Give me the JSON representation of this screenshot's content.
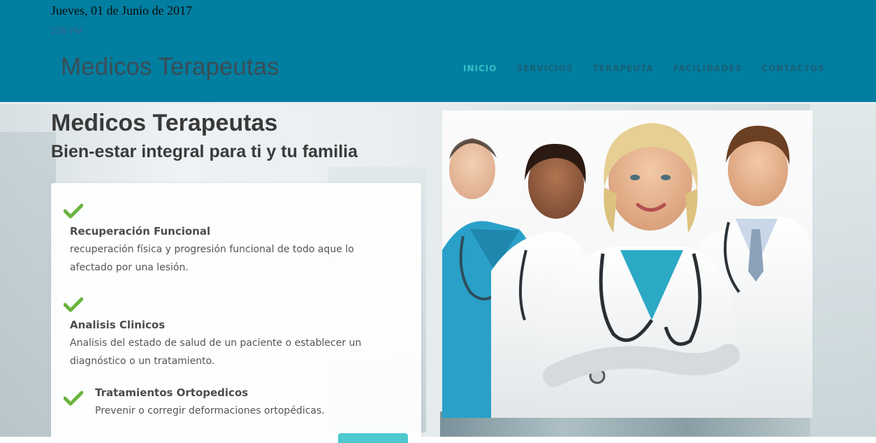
{
  "header": {
    "date": "Jueves, 01 de Junio de 2017",
    "time": "2:05 PM",
    "brand": "Medicos Terapeutas",
    "nav": [
      {
        "label": "INICIO",
        "active": true
      },
      {
        "label": "SERVICIOS",
        "active": false
      },
      {
        "label": "TERAPEUTA",
        "active": false
      },
      {
        "label": "FACILIDADES",
        "active": false
      },
      {
        "label": "CONTACTOS",
        "active": false
      }
    ]
  },
  "hero": {
    "title": "Medicos Terapeutas",
    "subtitle": "Bien-estar integral para ti y tu familia",
    "features": [
      {
        "title": "Recuperación Funcional",
        "desc": "recuperación física y progresión funcional de todo aque lo afectado por una lesión."
      },
      {
        "title": "Analisis Clinicos",
        "desc": "Analisis del estado de salud de un paciente o establecer un diagnóstico o un tratamiento."
      },
      {
        "title": "Tratamientos Ortopedicos",
        "desc": "Prevenir o corregir deformaciones ortopédicas."
      }
    ]
  },
  "colors": {
    "header_bg": "#017ea0",
    "nav_active": "#35c1c8",
    "nav_text": "#1a6077",
    "check_green": "#6ab43e",
    "accent_button": "#4ec9cf"
  },
  "icons": {
    "feature_check": "check-icon",
    "photo": "doctors-group-photo"
  }
}
